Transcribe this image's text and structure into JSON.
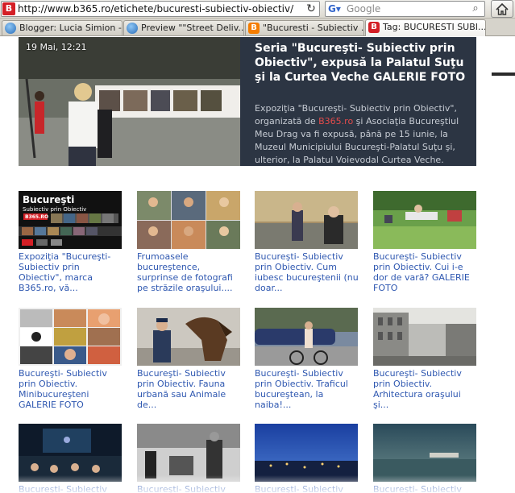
{
  "browser": {
    "url": "http://www.b365.ro/etichete/bucuresti-subiectiv-obiectiv/",
    "search_placeholder": "Google",
    "site_icon_letter": "B",
    "tabs": [
      {
        "label": "Blogger: Lucia Simion -...",
        "icon": "globe-icon"
      },
      {
        "label": "Preview \"\"Street Deliv...",
        "icon": "globe-icon"
      },
      {
        "label": "\"Bucuresti - Subiectiv ...",
        "icon": "blogger-icon"
      },
      {
        "label": "Tag: BUCURESTI SUBI...",
        "icon": "b365-icon"
      }
    ]
  },
  "hero": {
    "date": "19 Mai, 12:21",
    "title": "Seria \"Bucureşti- Subiectiv prin Obiectiv\", expusă la Palatul Suţu şi la Curtea Veche GALERIE FOTO",
    "excerpt_before": "Expoziţia \"Bucureşti- Subiectiv prin Obiectiv\", organizată de ",
    "excerpt_brand": "B365.ro",
    "excerpt_after": " şi Asociaţia Bucureştiul Meu Drag va fi expusă, până pe 15 iunie, la Muzeul Municipiului Bucureşti-Palatul Suţu şi, ulterior, la Palatul Voievodal Curtea Veche."
  },
  "articles": [
    {
      "caption": "Expoziţia \"Bucureşti-Subiectiv prin Obiectiv\", marca B365.ro, vă..."
    },
    {
      "caption": "Frumoasele bucureştence, surprinse de fotografi pe străzile oraşului...."
    },
    {
      "caption": "Bucureşti- Subiectiv prin Obiectiv. Cum iubesc bucureştenii (nu doar..."
    },
    {
      "caption": "Bucureşti- Subiectiv prin Obiectiv. Cui i-e dor de vară? GALERIE FOTO"
    },
    {
      "caption": "Bucureşti- Subiectiv prin Obiectiv. Minibucureşteni GALERIE FOTO"
    },
    {
      "caption": "Bucureşti- Subiectiv prin Obiectiv. Fauna urbană sau Animale de..."
    },
    {
      "caption": "Bucureşti- Subiectiv prin Obiectiv. Traficul bucureştean, la naiba!..."
    },
    {
      "caption": "Bucureşti- Subiectiv prin Obiectiv. Arhitectura oraşului şi..."
    },
    {
      "caption": "Bucureşti- Subiectiv"
    },
    {
      "caption": "Bucureşti- Subiectiv"
    },
    {
      "caption": "Bucureşti- Subiectiv"
    },
    {
      "caption": "Bucureşti- Subiectiv"
    }
  ],
  "poster": {
    "title": "Bucureşti",
    "subtitle": "Subiectiv prin Obiectiv",
    "logo": "B365.RO"
  },
  "colors": {
    "link": "#2e57b0",
    "hero_bg": "#2c3543",
    "brand_red": "#d41f26"
  }
}
